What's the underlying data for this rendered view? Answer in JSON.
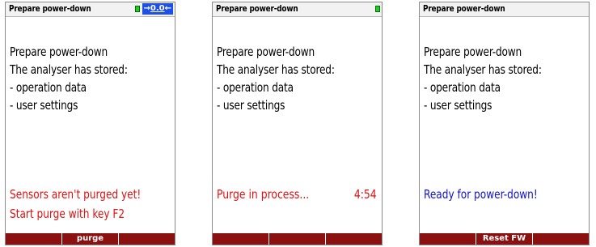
{
  "screens": [
    {
      "title": "Prepare power-down",
      "status": {
        "arrow": "→",
        "value": "0.0",
        "back_arrow": "←"
      },
      "heading": "Prepare power-down",
      "stored_text": "The analyser has stored:",
      "items": [
        "- operation data",
        "- user settings"
      ],
      "message_lines": [
        "Sensors aren't purged yet!",
        "Start purge with key F2"
      ],
      "message_color": "#e01010",
      "softkeys": [
        "",
        "purge",
        ""
      ]
    },
    {
      "title": "Prepare power-down",
      "heading": "Prepare power-down",
      "stored_text": "The analyser has stored:",
      "items": [
        "- operation data",
        "- user settings"
      ],
      "message_line": "Purge in process...",
      "message_time": "4:54",
      "message_color": "#e01010",
      "softkeys": [
        "",
        "",
        ""
      ]
    },
    {
      "title": "Prepare power-down",
      "heading": "Prepare power-down",
      "stored_text": "The analyser has stored:",
      "items": [
        "- operation data",
        "- user settings"
      ],
      "message_line": "Ready for power-down!",
      "message_color": "#1010d0",
      "softkeys": [
        "",
        "Reset FW",
        ""
      ]
    }
  ],
  "colors": {
    "softkey_bar": "#8b1010",
    "battery": "#1fcf1f",
    "info_badge": "#1e50e6"
  },
  "icons": {
    "battery": "battery-icon"
  }
}
